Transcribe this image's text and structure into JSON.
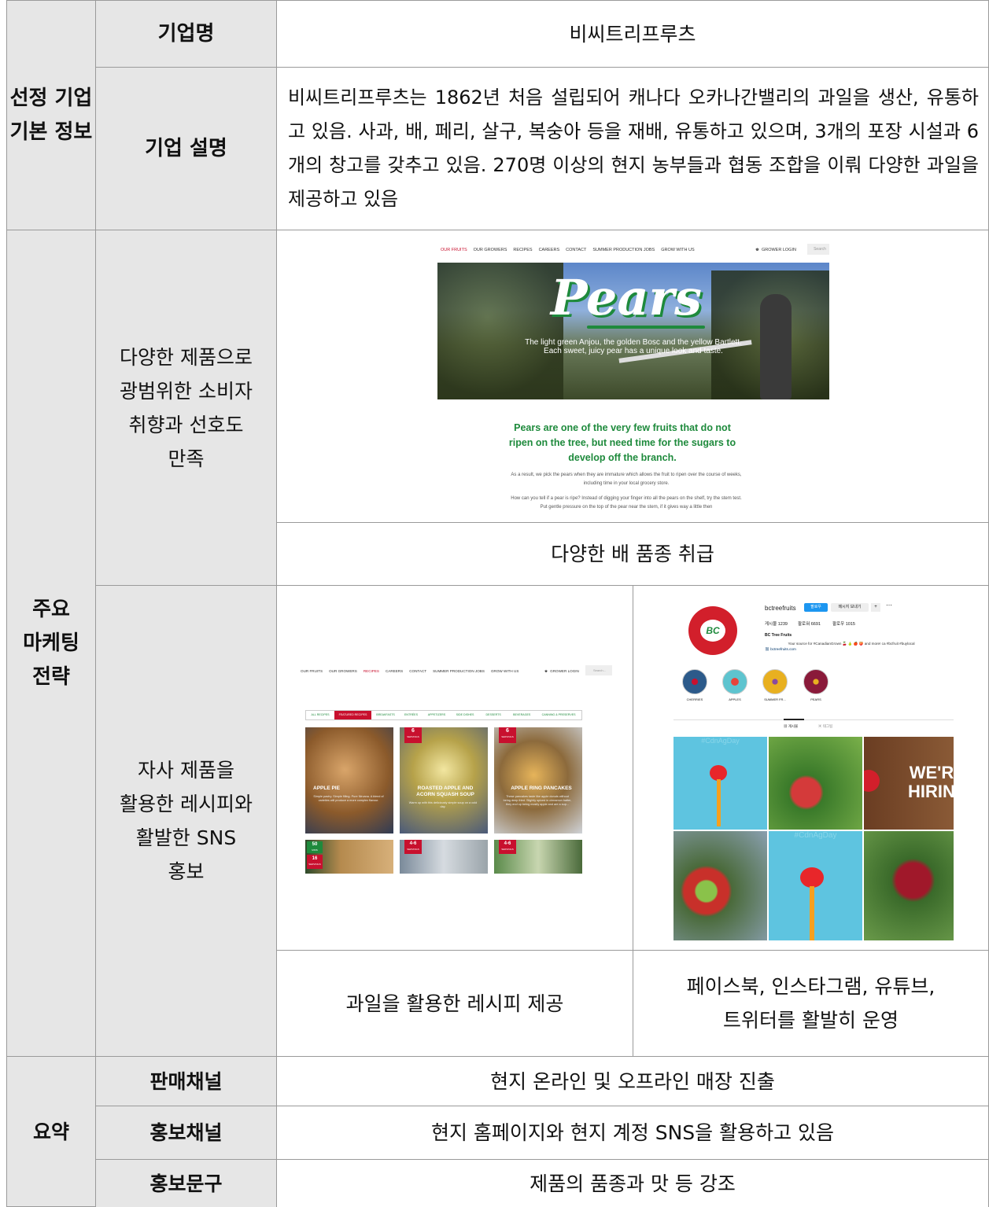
{
  "section1": {
    "label": "선정 기업\n기본 정보",
    "company_name_label": "기업명",
    "company_name": "비씨트리프루츠",
    "company_desc_label": "기업 설명",
    "company_desc": "비씨트리프루츠는 1862년 처음 설립되어 캐나다 오카나간밸리의 과일을 생산, 유통하고 있음. 사과, 배, 페리, 살구, 복숭아 등을 재배, 유통하고 있으며, 3개의 포장 시설과 6개의 창고를 갖추고 있음. 270명 이상의 현지 농부들과 협동 조합을 이뤄 다양한 과일을 제공하고 있음"
  },
  "section2": {
    "label": "주요\n마케팅\n전략",
    "strategy1": "다양한 제품으로\n광범위한 소비자\n취향과 선호도\n만족",
    "strategy1_caption": "다양한 배 품종 취급",
    "strategy2": "자사 제품을\n활용한 레시피와\n활발한 SNS\n홍보",
    "strategy2_caption_left": "과일을 활용한 레시피 제공",
    "strategy2_caption_right": "페이스북, 인스타그램, 유튜브,\n트위터를 활발히 운영"
  },
  "pears_site": {
    "nav": [
      "OUR FRUITS",
      "OUR GROWERS",
      "RECIPES",
      "CAREERS",
      "CONTACT",
      "SUMMER PRODUCTION JOBS",
      "GROW WITH US"
    ],
    "grower_login": "GROWER LOGIN",
    "search_placeholder": "Search",
    "hero_title": "Pears",
    "hero_line1": "The light green Anjou, the golden Bosc and the yellow Bartlett.",
    "hero_line2": "Each sweet, juicy pear has a unique look and taste.",
    "headline": "Pears are one of the very few fruits that do not ripen on the tree, but need time for the sugars to develop off the branch.",
    "para1": "As a result, we pick the pears when they are immature which allows the fruit to ripen over the course of weeks, including time in your local grocery store.",
    "para2": "How can you tell if a pear is ripe? Instead of digging your finger into all the pears on the shelf, try the stem test. Put gentle pressure on the top of the pear near the stem, if it gives way a little then"
  },
  "recipes_site": {
    "nav": [
      "OUR FRUITS",
      "OUR GROWERS",
      "RECIPES",
      "CAREERS",
      "CONTACT",
      "SUMMER PRODUCTION JOBS",
      "GROW WITH US"
    ],
    "grower_login": "GROWER LOGIN",
    "search_placeholder": "Search...",
    "filters": [
      "ALL RECIPES",
      "FEATURED RECIPES",
      "BREAKFASTS",
      "ENTRÉES",
      "APPETIZERS",
      "SIDE DISHES",
      "DESSERTS",
      "BEVERAGES",
      "CANNING & PRESERVES"
    ],
    "cards": [
      {
        "title": "APPLE PIE",
        "text": "Simple pastry. Simple filling. Pure Nirvana. A blend of varieties will produce a more complex flavour.",
        "badge": ""
      },
      {
        "title": "ROASTED APPLE AND ACORN SQUASH SOUP",
        "text": "Warm up with this deliciously simple soup on a cold day.",
        "badge": "6",
        "badge_sub": "SERVINGS"
      },
      {
        "title": "APPLE RING PANCAKES",
        "text": "These pancakes taste like apple donuts without being deep fried. Slightly spiced in cinnamon batter, they end up being mostly apple and are a sup...",
        "badge": "6",
        "badge_sub": "SERVINGS"
      }
    ],
    "bottom_badges": [
      {
        "top": "50",
        "top_sub": "MINS",
        "bottom": "16",
        "bottom_sub": "SERVINGS"
      },
      {
        "top": "4-6",
        "top_sub": "SERVINGS"
      },
      {
        "top": "4-6",
        "top_sub": "SERVINGS"
      }
    ]
  },
  "instagram": {
    "username": "bctreefruits",
    "follow": "팔로우",
    "message": "메시지 보내기",
    "posts": "게시물 1239",
    "followers": "팔로워 6691",
    "following": "팔로우 1015",
    "display_name": "BC Tree Fruits",
    "bio": "Your source for #CanadianGrown 🍒 🍐 🍎 🍑 and more! ca #bcfruit #buylocal",
    "link": "bctreefruits.com",
    "logo_text": "BC",
    "highlights": [
      "CHERRIES",
      "APPLES",
      "SUMMER FR...",
      "PEARS"
    ],
    "tabs": [
      "게시물",
      "태그됨"
    ],
    "hashtag": "#CdnAgDay",
    "hiring_text": "WE'R HIRIN"
  },
  "summary": {
    "label": "요약",
    "rows": [
      {
        "label": "판매채널",
        "value": "현지 온라인 및 오프라인 매장 진출"
      },
      {
        "label": "홍보채널",
        "value": "현지 홈페이지와 현지 계정 SNS을 활용하고 있음"
      },
      {
        "label": "홍보문구",
        "value": "제품의 품종과 맛 등 강조"
      }
    ]
  },
  "colors": {
    "header_bg": "#e6e6e6",
    "border": "#9a9a9a",
    "brand_green": "#1e8a3c",
    "brand_red": "#c8102e",
    "instagram_blue": "#1c96f0"
  }
}
